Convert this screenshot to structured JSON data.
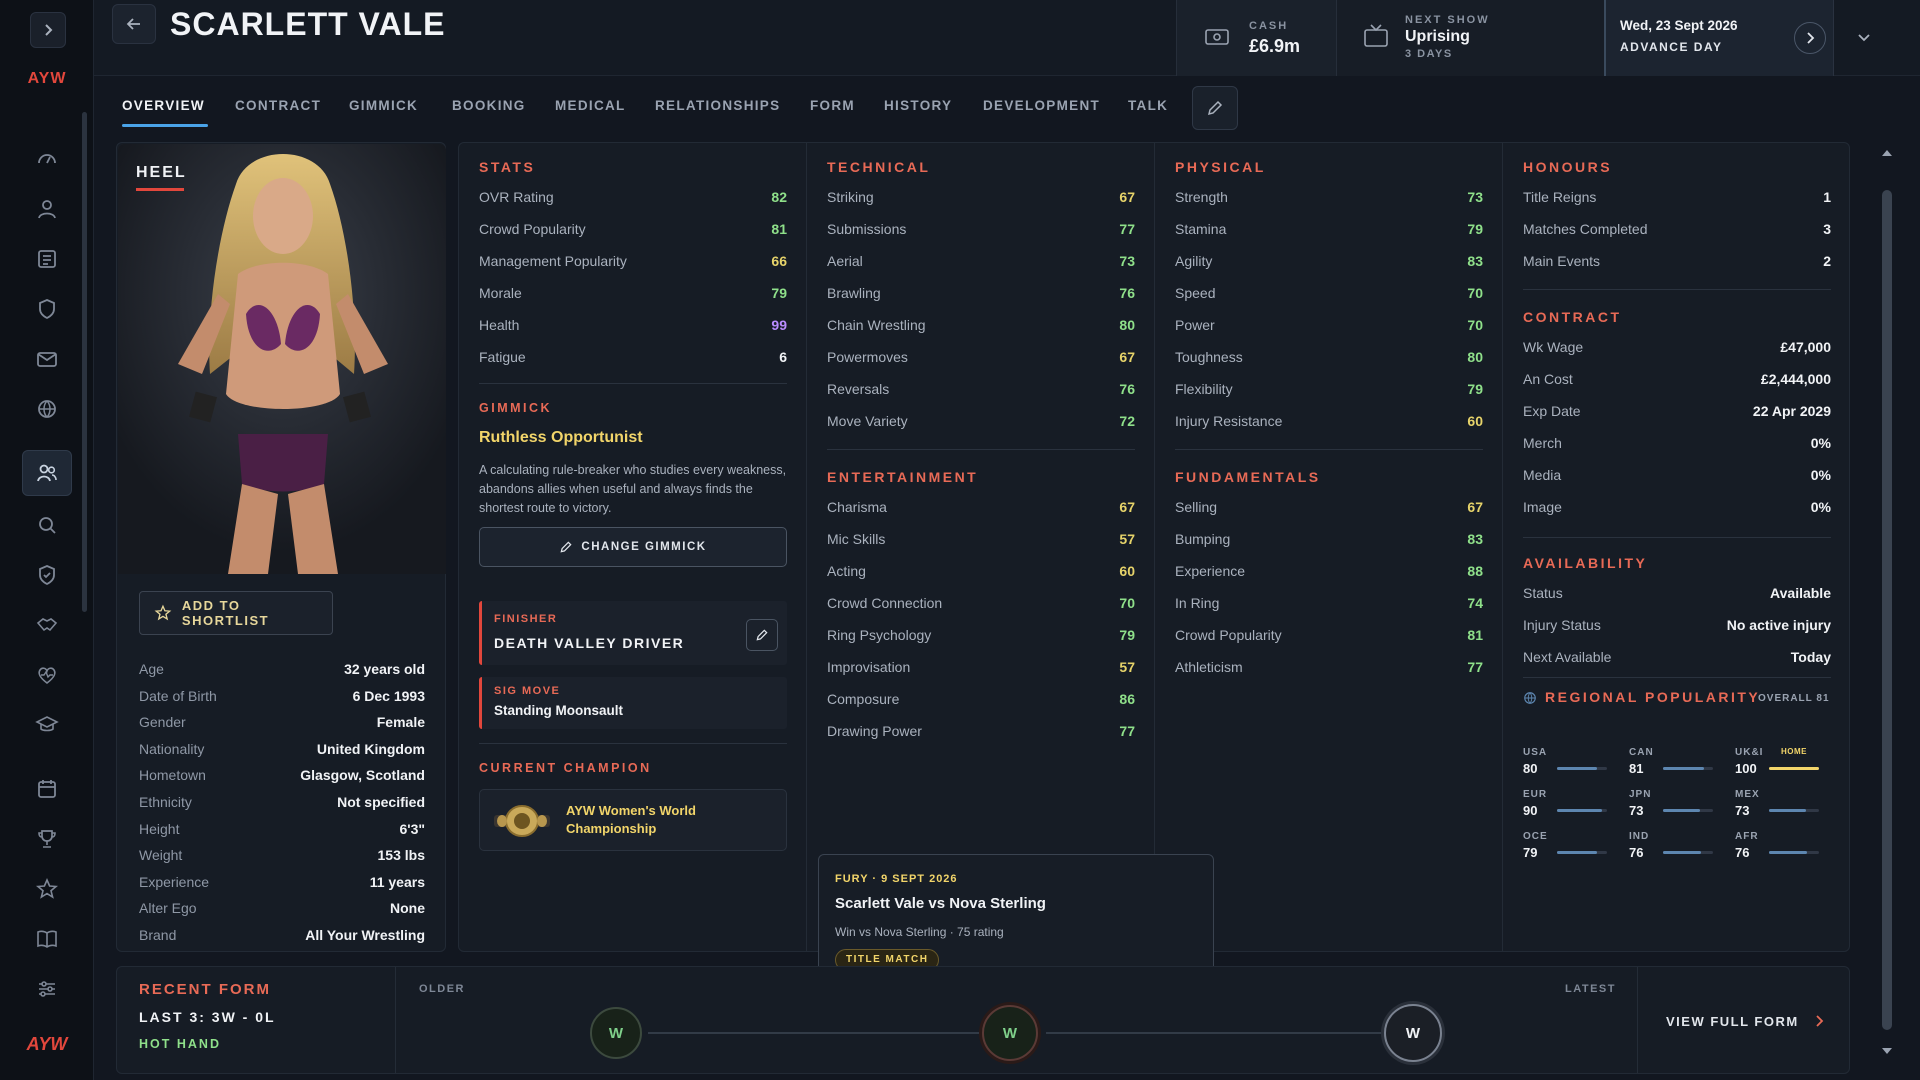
{
  "app": {
    "logo": "AYW",
    "bottom_logo": "AYW"
  },
  "header": {
    "title": "SCARLETT VALE",
    "cash_label": "CASH",
    "cash_value": "£6.9m",
    "next_show_label": "NEXT SHOW",
    "next_show_value": "Uprising",
    "next_show_sub": "3 DAYS",
    "date": "Wed, 23 Sept 2026",
    "advance_label": "ADVANCE DAY"
  },
  "tabs": [
    "OVERVIEW",
    "CONTRACT",
    "GIMMICK",
    "BOOKING",
    "MEDICAL",
    "RELATIONSHIPS",
    "FORM",
    "HISTORY",
    "DEVELOPMENT",
    "TALK"
  ],
  "profile": {
    "alignment": "HEEL",
    "shortlist_label": "ADD TO SHORTLIST",
    "bio": [
      {
        "k": "Age",
        "v": "32 years old"
      },
      {
        "k": "Date of Birth",
        "v": "6 Dec 1993"
      },
      {
        "k": "Gender",
        "v": "Female"
      },
      {
        "k": "Nationality",
        "v": "United Kingdom"
      },
      {
        "k": "Hometown",
        "v": "Glasgow, Scotland"
      },
      {
        "k": "Ethnicity",
        "v": "Not specified"
      },
      {
        "k": "Height",
        "v": "6'3\""
      },
      {
        "k": "Weight",
        "v": "153 lbs"
      },
      {
        "k": "Experience",
        "v": "11 years"
      },
      {
        "k": "Alter Ego",
        "v": "None"
      },
      {
        "k": "Brand",
        "v": "All Your Wrestling"
      }
    ]
  },
  "stats": {
    "title": "STATS",
    "rows": [
      {
        "k": "OVR Rating",
        "v": "82"
      },
      {
        "k": "Crowd Popularity",
        "v": "81"
      },
      {
        "k": "Management Popularity",
        "v": "66"
      },
      {
        "k": "Morale",
        "v": "79"
      },
      {
        "k": "Health",
        "v": "99"
      },
      {
        "k": "Fatigue",
        "v": "6"
      }
    ]
  },
  "gimmick": {
    "title": "GIMMICK",
    "name": "Ruthless Opportunist",
    "desc": "A calculating rule-breaker who studies every weakness, abandons allies when useful and always finds the shortest route to victory.",
    "button": "CHANGE GIMMICK",
    "finisher_label": "FINISHER",
    "finisher": "DEATH VALLEY DRIVER",
    "sig_label": "SIG MOVE",
    "sig": "Standing Moonsault",
    "champion_label": "CURRENT CHAMPION",
    "champion": "AYW Women's World Championship"
  },
  "technical": {
    "title": "TECHNICAL",
    "rows": [
      {
        "k": "Striking",
        "v": "67"
      },
      {
        "k": "Submissions",
        "v": "77"
      },
      {
        "k": "Aerial",
        "v": "73"
      },
      {
        "k": "Brawling",
        "v": "76"
      },
      {
        "k": "Chain Wrestling",
        "v": "80"
      },
      {
        "k": "Powermoves",
        "v": "67"
      },
      {
        "k": "Reversals",
        "v": "76"
      },
      {
        "k": "Move Variety",
        "v": "72"
      }
    ]
  },
  "entertainment": {
    "title": "ENTERTAINMENT",
    "rows": [
      {
        "k": "Charisma",
        "v": "67"
      },
      {
        "k": "Mic Skills",
        "v": "57"
      },
      {
        "k": "Acting",
        "v": "60"
      },
      {
        "k": "Crowd Connection",
        "v": "70"
      },
      {
        "k": "Ring Psychology",
        "v": "79"
      },
      {
        "k": "Improvisation",
        "v": "57"
      },
      {
        "k": "Composure",
        "v": "86"
      },
      {
        "k": "Drawing Power",
        "v": "77"
      }
    ]
  },
  "physical": {
    "title": "PHYSICAL",
    "rows": [
      {
        "k": "Strength",
        "v": "73"
      },
      {
        "k": "Stamina",
        "v": "79"
      },
      {
        "k": "Agility",
        "v": "83"
      },
      {
        "k": "Speed",
        "v": "70"
      },
      {
        "k": "Power",
        "v": "70"
      },
      {
        "k": "Toughness",
        "v": "80"
      },
      {
        "k": "Flexibility",
        "v": "79"
      },
      {
        "k": "Injury Resistance",
        "v": "60"
      }
    ]
  },
  "fundamentals": {
    "title": "FUNDAMENTALS",
    "rows": [
      {
        "k": "Selling",
        "v": "67"
      },
      {
        "k": "Bumping",
        "v": "83"
      },
      {
        "k": "Experience",
        "v": "88"
      },
      {
        "k": "In Ring",
        "v": "74"
      },
      {
        "k": "Crowd Popularity",
        "v": "81"
      },
      {
        "k": "Athleticism",
        "v": "77"
      }
    ]
  },
  "honours": {
    "title": "HONOURS",
    "rows": [
      {
        "k": "Title Reigns",
        "v": "1"
      },
      {
        "k": "Matches Completed",
        "v": "3"
      },
      {
        "k": "Main Events",
        "v": "2"
      }
    ]
  },
  "contract": {
    "title": "CONTRACT",
    "rows": [
      {
        "k": "Wk Wage",
        "v": "£47,000"
      },
      {
        "k": "An Cost",
        "v": "£2,444,000"
      },
      {
        "k": "Exp Date",
        "v": "22 Apr 2029"
      },
      {
        "k": "Merch",
        "v": "0%"
      },
      {
        "k": "Media",
        "v": "0%"
      },
      {
        "k": "Image",
        "v": "0%"
      }
    ]
  },
  "availability": {
    "title": "AVAILABILITY",
    "rows": [
      {
        "k": "Status",
        "v": "Available"
      },
      {
        "k": "Injury Status",
        "v": "No active injury"
      },
      {
        "k": "Next Available",
        "v": "Today"
      }
    ]
  },
  "regional": {
    "title": "REGIONAL POPULARITY",
    "overall": "OVERALL 81",
    "home_label": "HOME",
    "items": [
      {
        "c": "USA",
        "n": "80",
        "level": 0.8,
        "home": false
      },
      {
        "c": "CAN",
        "n": "81",
        "level": 0.81,
        "home": false
      },
      {
        "c": "UK&I",
        "n": "100",
        "level": 1.0,
        "home": true
      },
      {
        "c": "EUR",
        "n": "90",
        "level": 0.9,
        "home": false
      },
      {
        "c": "JPN",
        "n": "73",
        "level": 0.73,
        "home": false
      },
      {
        "c": "MEX",
        "n": "73",
        "level": 0.73,
        "home": false
      },
      {
        "c": "OCE",
        "n": "79",
        "level": 0.79,
        "home": false
      },
      {
        "c": "IND",
        "n": "76",
        "level": 0.76,
        "home": false
      },
      {
        "c": "AFR",
        "n": "76",
        "level": 0.76,
        "home": false
      }
    ]
  },
  "tooltip": {
    "event": "FURY · 9 SEPT 2026",
    "match": "Scarlett Vale vs Nova Sterling",
    "detail": "Win vs Nova Sterling · 75 rating",
    "badge": "TITLE MATCH"
  },
  "form": {
    "title": "RECENT FORM",
    "summary": "LAST 3: 3W - 0L",
    "streak": "HOT HAND",
    "older_label": "OLDER",
    "latest_label": "LATEST",
    "results": [
      "W",
      "W",
      "W"
    ],
    "view_label": "VIEW FULL FORM"
  },
  "colors": {
    "accent": "#e86a56",
    "gold": "#f2d56a",
    "health": "#b98cff",
    "stat_good": "#8fe08a",
    "stat_mid": "#e6d36a",
    "stat_low": "#e2473c"
  }
}
